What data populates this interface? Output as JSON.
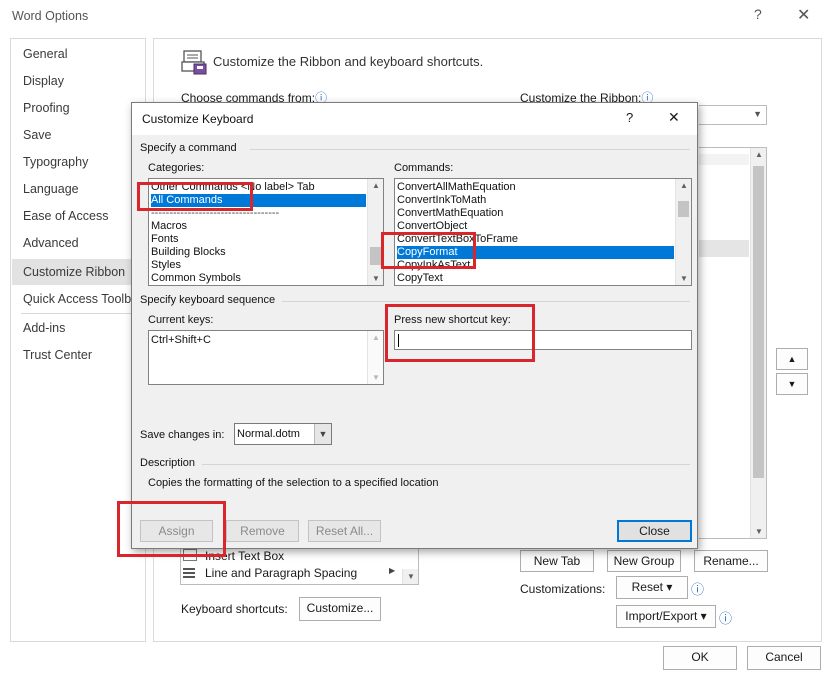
{
  "window": {
    "title": "Word Options",
    "help_glyph": "?",
    "close_glyph": "✕",
    "nav": [
      "General",
      "Display",
      "Proofing",
      "Save",
      "Typography",
      "Language",
      "Ease of Access",
      "Advanced",
      "Customize Ribbon",
      "Quick Access Toolba",
      "Add-ins",
      "Trust Center"
    ],
    "selected_nav": "Customize Ribbon",
    "ok": "OK",
    "cancel": "Cancel"
  },
  "ribbon_page": {
    "heading": "Customize the Ribbon and keyboard shortcuts.",
    "choose_from": "Choose commands from:",
    "customize_ribbon": "Customize the Ribbon:",
    "info_glyph": "ⓘ",
    "partial_list": [
      "Insert Text Box",
      "Line and Paragraph Spacing"
    ],
    "keyboard_shortcuts": "Keyboard shortcuts:",
    "customize_btn": "Customize...",
    "new_tab": "New Tab",
    "new_group": "New Group",
    "rename": "Rename...",
    "customizations": "Customizations:",
    "reset": "Reset ▾",
    "import_export": "Import/Export ▾"
  },
  "dialog": {
    "title": "Customize Keyboard",
    "help_glyph": "?",
    "close_glyph": "✕",
    "specify_command": "Specify a command",
    "categories_label": "Categories:",
    "categories": [
      "Other Commands  <No label>  Tab",
      "All Commands",
      "-----------------------------------",
      "Macros",
      "Fonts",
      "Building Blocks",
      "Styles",
      "Common Symbols"
    ],
    "selected_category": "All Commands",
    "commands_label": "Commands:",
    "commands": [
      "ConvertAllMathEquation",
      "ConvertInkToMath",
      "ConvertMathEquation",
      "ConvertObject",
      "ConvertTextBoxToFrame",
      "CopyFormat",
      "CopyInkAsText",
      "CopyText"
    ],
    "selected_command": "CopyFormat",
    "specify_sequence": "Specify keyboard sequence",
    "current_keys_label": "Current keys:",
    "current_keys": [
      "Ctrl+Shift+C"
    ],
    "new_key_label": "Press new shortcut key:",
    "new_key_value": "",
    "save_changes_label": "Save changes in:",
    "save_changes_value": "Normal.dotm",
    "description_label": "Description",
    "description": "Copies the formatting of the selection to a specified location",
    "assign": "Assign",
    "remove": "Remove",
    "reset_all": "Reset All...",
    "close": "Close"
  },
  "colors": {
    "selection": "#0078d7",
    "highlight_annotation": "#d9262c"
  }
}
